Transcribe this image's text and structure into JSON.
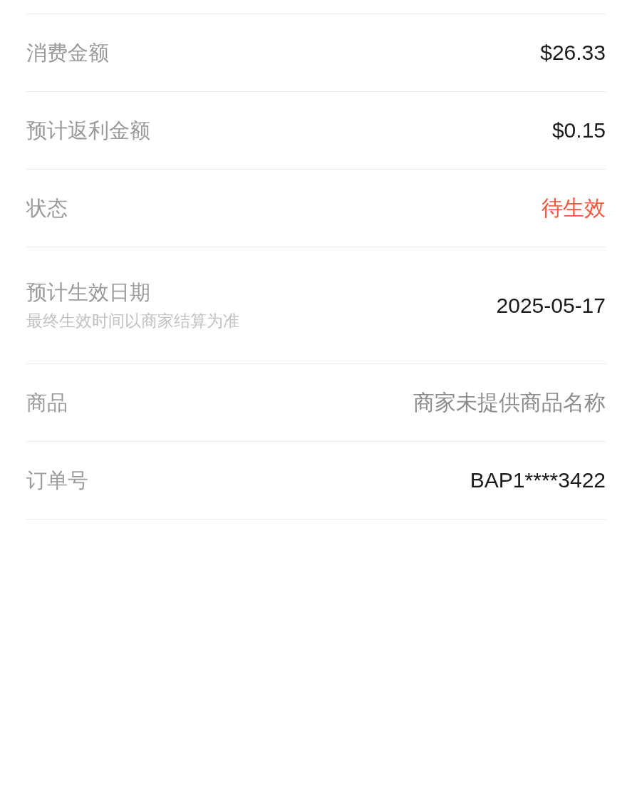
{
  "rows": [
    {
      "label": "消费金额",
      "value": "$26.33",
      "kind": "plain"
    },
    {
      "label": "预计返利金额",
      "value": "$0.15",
      "kind": "plain"
    },
    {
      "label": "状态",
      "value": "待生效",
      "kind": "alert"
    },
    {
      "label": "预计生效日期",
      "note": "最终生效时间以商家结算为准",
      "value": "2025-05-17",
      "kind": "plain"
    },
    {
      "label": "商品",
      "value": "商家未提供商品名称",
      "kind": "muted"
    },
    {
      "label": "订单号",
      "value": "BAP1****3422",
      "kind": "plain"
    }
  ]
}
